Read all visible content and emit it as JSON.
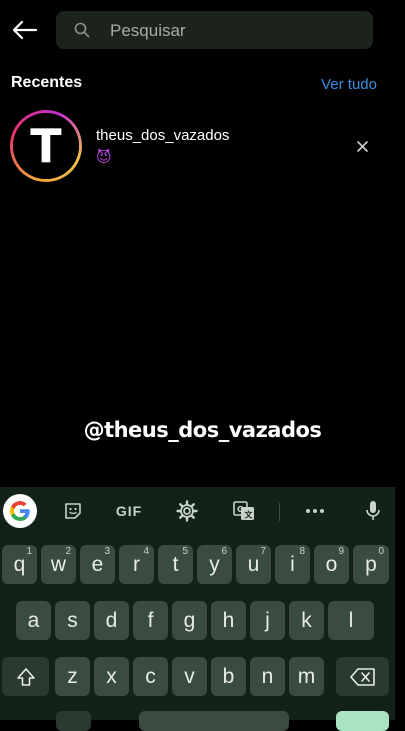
{
  "search": {
    "placeholder": "Pesquisar"
  },
  "recent": {
    "title": "Recentes",
    "see_all": "Ver tudo",
    "items": [
      {
        "avatar_letter": "T",
        "username": "theus_dos_vazados",
        "emoji": "😈"
      }
    ]
  },
  "caption": "@theus_dos_vazados",
  "keyboard": {
    "gif_label": "GIF",
    "row1": [
      {
        "k": "q",
        "h": "1"
      },
      {
        "k": "w",
        "h": "2"
      },
      {
        "k": "e",
        "h": "3"
      },
      {
        "k": "r",
        "h": "4"
      },
      {
        "k": "t",
        "h": "5"
      },
      {
        "k": "y",
        "h": "6"
      },
      {
        "k": "u",
        "h": "7"
      },
      {
        "k": "i",
        "h": "8"
      },
      {
        "k": "o",
        "h": "9"
      },
      {
        "k": "p",
        "h": "0"
      }
    ],
    "row2": [
      "a",
      "s",
      "d",
      "f",
      "g",
      "h",
      "j",
      "k",
      "l"
    ],
    "row3": [
      "z",
      "x",
      "c",
      "v",
      "b",
      "n",
      "m"
    ]
  },
  "colors": {
    "accent_link": "#3a8fdf",
    "keyboard_bg": "#122219",
    "key_bg": "#3a4c42",
    "search_bg": "#1b231c"
  }
}
